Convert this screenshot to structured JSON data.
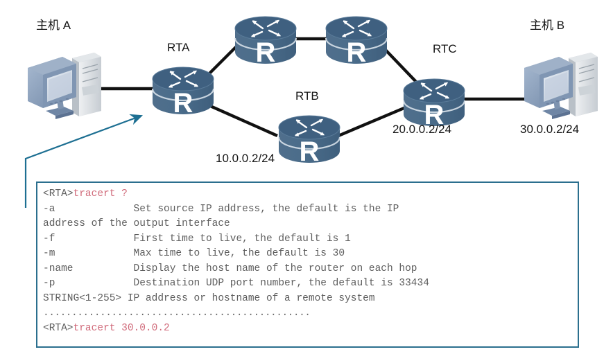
{
  "diagram": {
    "hosts": [
      {
        "id": "host-a",
        "label": "主机 A"
      },
      {
        "id": "host-b",
        "label": "主机 B"
      }
    ],
    "routers": [
      {
        "id": "rta",
        "label": "RTA",
        "glyph": "R"
      },
      {
        "id": "rtb",
        "label": "RTB",
        "glyph": "R"
      },
      {
        "id": "rtc",
        "label": "RTC",
        "glyph": "R"
      },
      {
        "id": "rt-top-left",
        "label": "",
        "glyph": "R"
      },
      {
        "id": "rt-top-right",
        "label": "",
        "glyph": "R"
      }
    ],
    "ip_labels": [
      {
        "id": "ip-rtb",
        "text": "10.0.0.2/24"
      },
      {
        "id": "ip-rtc",
        "text": "20.0.0.2/24"
      },
      {
        "id": "ip-host-b",
        "text": "30.0.0.2/24"
      }
    ],
    "colors": {
      "router_body": "#4c6f8c",
      "router_top": "#3e5d78",
      "link": "#111111",
      "callout": "#1d6f92",
      "box_border": "#2b6f8e",
      "monitor_bezel": "#8ea2bd",
      "tower": "#d5d9dc"
    },
    "callout": {
      "name": "callout-arrow",
      "target": "RTA"
    }
  },
  "console": {
    "lines": [
      {
        "prompt": "<RTA>",
        "cmd": "tracert ?",
        "rest": ""
      },
      {
        "prompt": "",
        "cmd": "",
        "rest": "-a             Set source IP address, the default is the IP"
      },
      {
        "prompt": "",
        "cmd": "",
        "rest": "address of the output interface"
      },
      {
        "prompt": "",
        "cmd": "",
        "rest": "-f             First time to live, the default is 1"
      },
      {
        "prompt": "",
        "cmd": "",
        "rest": "-m             Max time to live, the default is 30"
      },
      {
        "prompt": "",
        "cmd": "",
        "rest": "-name          Display the host name of the router on each hop"
      },
      {
        "prompt": "",
        "cmd": "",
        "rest": "-p             Destination UDP port number, the default is 33434"
      },
      {
        "prompt": "",
        "cmd": "",
        "rest": "STRING<1-255> IP address or hostname of a remote system"
      },
      {
        "prompt": "",
        "cmd": "",
        "rest": "..............................................."
      },
      {
        "prompt": "<RTA>",
        "cmd": "tracert 30.0.0.2",
        "rest": ""
      }
    ]
  }
}
